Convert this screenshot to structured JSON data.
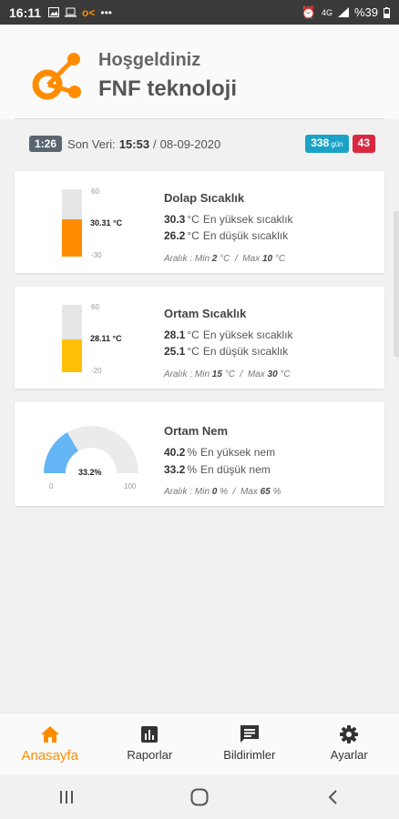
{
  "status_bar": {
    "time": "16:11",
    "battery": "%39",
    "network": "4G",
    "icons": [
      "image-icon",
      "laptop-icon",
      "app-logo-icon",
      "more-dots-icon",
      "alarm-icon",
      "signal-icon",
      "battery-icon"
    ]
  },
  "header": {
    "welcome": "Hoşgeldiniz",
    "company": "FNF teknoloji",
    "logo_color": "#ff8c00"
  },
  "info": {
    "elapsed": "1:26",
    "last_data_label": "Son Veri:",
    "last_data_time": "15:53",
    "separator": "/",
    "last_data_date": "08-09-2020",
    "days_value": "338",
    "days_unit": "gün",
    "alert_count": "43"
  },
  "cards": [
    {
      "title": "Dolap Sıcaklık",
      "current": "30.31 °C",
      "level_fraction": 0.55,
      "fill_color": "#ff8c00",
      "scale_max": "60",
      "scale_min": "-30",
      "high_value": "30.3",
      "high_unit": "°C",
      "high_label": "En yüksek sıcaklık",
      "low_value": "26.2",
      "low_unit": "°C",
      "low_label": "En düşük sıcaklık",
      "range_label": "Aralık : Min",
      "range_min": "2",
      "range_min_unit": "°C",
      "range_sep": "/",
      "range_max_label": "Max",
      "range_max": "10",
      "range_max_unit": "°C"
    },
    {
      "title": "Ortam Sıcaklık",
      "current": "28.11 °C",
      "level_fraction": 0.48,
      "fill_color": "#ffc107",
      "scale_max": "60",
      "scale_min": "-20",
      "high_value": "28.1",
      "high_unit": "°C",
      "high_label": "En yüksek sıcaklık",
      "low_value": "25.1",
      "low_unit": "°C",
      "low_label": "En düşük sıcaklık",
      "range_label": "Aralık : Min",
      "range_min": "15",
      "range_min_unit": "°C",
      "range_sep": "/",
      "range_max_label": "Max",
      "range_max": "30",
      "range_max_unit": "°C"
    },
    {
      "title": "Ortam Nem",
      "current": "33.2%",
      "gauge_fraction": 0.332,
      "fill_color": "#64b5f6",
      "scale_min": "0",
      "scale_max": "100",
      "high_value": "40.2",
      "high_unit": "%",
      "high_label": "En yüksek nem",
      "low_value": "33.2",
      "low_unit": "%",
      "low_label": "En düşük nem",
      "range_label": "Aralık : Min",
      "range_min": "0",
      "range_min_unit": "%",
      "range_sep": "/",
      "range_max_label": "Max",
      "range_max": "65",
      "range_max_unit": "%"
    }
  ],
  "bottom_nav": [
    {
      "label": "Anasayfa",
      "icon": "home-icon",
      "active": true
    },
    {
      "label": "Raporlar",
      "icon": "chart-icon",
      "active": false
    },
    {
      "label": "Bildirimler",
      "icon": "message-icon",
      "active": false
    },
    {
      "label": "Ayarlar",
      "icon": "gear-icon",
      "active": false
    }
  ],
  "system_nav": [
    "recent-apps-icon",
    "home-circle-icon",
    "back-icon"
  ],
  "colors": {
    "accent": "#ff8c00",
    "teal": "#1aa3c6",
    "red": "#d9283f",
    "dark": "#5a6770"
  }
}
